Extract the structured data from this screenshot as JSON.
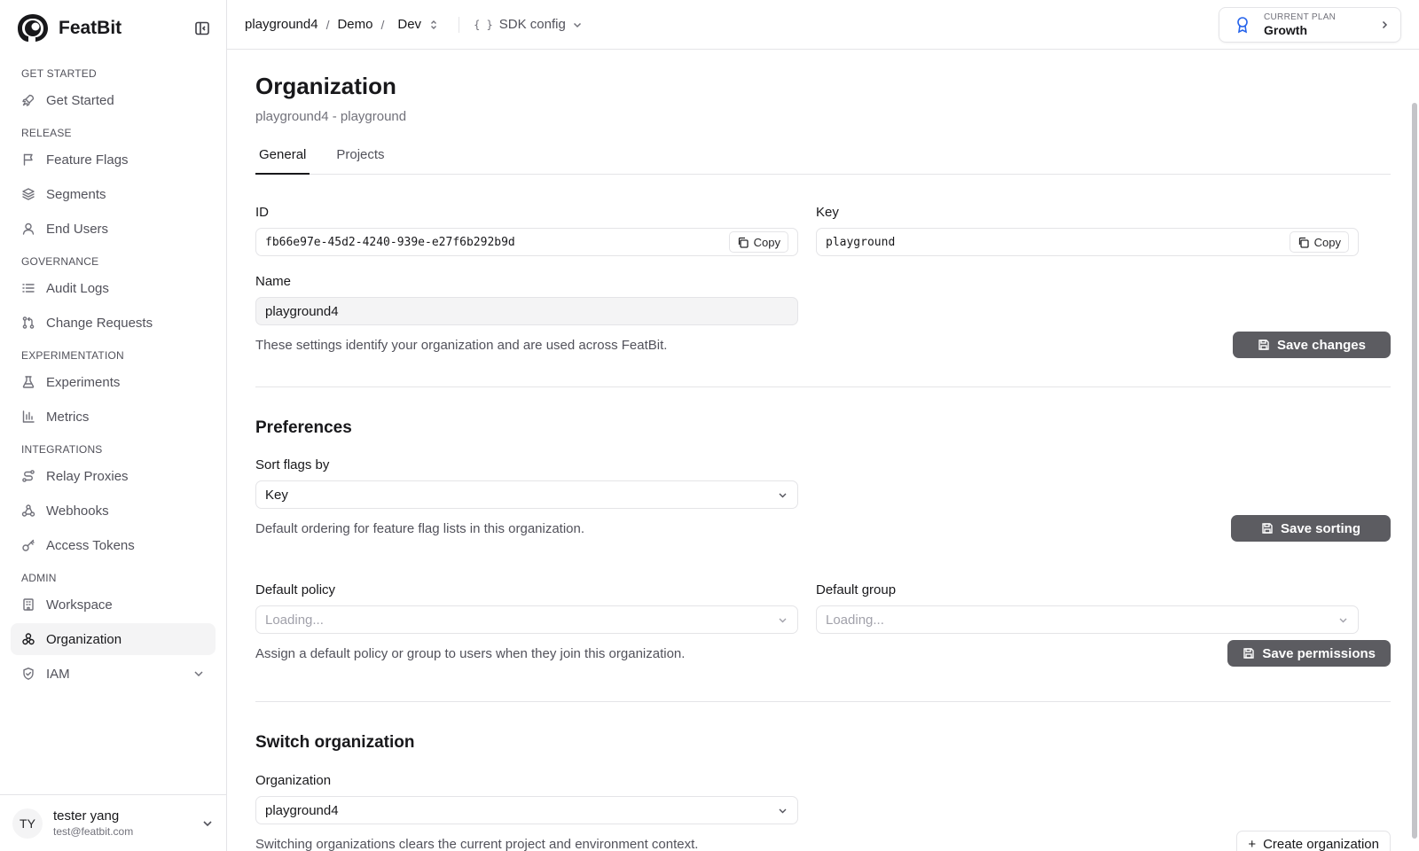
{
  "brand": {
    "name": "FeatBit"
  },
  "sidebar": {
    "groups": [
      {
        "title": "GET STARTED",
        "items": [
          {
            "label": "Get Started",
            "icon": "rocket-icon"
          }
        ]
      },
      {
        "title": "RELEASE",
        "items": [
          {
            "label": "Feature Flags",
            "icon": "flag-icon"
          },
          {
            "label": "Segments",
            "icon": "layers-icon"
          },
          {
            "label": "End Users",
            "icon": "user-icon"
          }
        ]
      },
      {
        "title": "GOVERNANCE",
        "items": [
          {
            "label": "Audit Logs",
            "icon": "list-icon"
          },
          {
            "label": "Change Requests",
            "icon": "git-pull-request-icon"
          }
        ]
      },
      {
        "title": "EXPERIMENTATION",
        "items": [
          {
            "label": "Experiments",
            "icon": "flask-icon"
          },
          {
            "label": "Metrics",
            "icon": "bar-chart-icon"
          }
        ]
      },
      {
        "title": "INTEGRATIONS",
        "items": [
          {
            "label": "Relay Proxies",
            "icon": "route-icon"
          },
          {
            "label": "Webhooks",
            "icon": "webhook-icon"
          },
          {
            "label": "Access Tokens",
            "icon": "key-icon"
          }
        ]
      },
      {
        "title": "ADMIN",
        "items": [
          {
            "label": "Workspace",
            "icon": "building-icon"
          },
          {
            "label": "Organization",
            "icon": "organization-icon",
            "active": true
          },
          {
            "label": "IAM",
            "icon": "shield-icon",
            "expandable": true
          }
        ]
      }
    ]
  },
  "user": {
    "initials": "TY",
    "name": "tester yang",
    "email": "test@featbit.com"
  },
  "topbar": {
    "org": "playground4",
    "project": "Demo",
    "env": "Dev",
    "sdk_braces": "{ }",
    "sdk_label": "SDK config",
    "plan_label": "CURRENT PLAN",
    "plan_name": "Growth"
  },
  "page": {
    "title": "Organization",
    "subtitle": "playground4 - playground",
    "tabs": [
      "General",
      "Projects"
    ],
    "active_tab": "General"
  },
  "general": {
    "id_label": "ID",
    "id_value": "fb66e97e-45d2-4240-939e-e27f6b292b9d",
    "key_label": "Key",
    "key_value": "playground",
    "copy_label": "Copy",
    "name_label": "Name",
    "name_value": "playground4",
    "help": "These settings identify your organization and are used across FeatBit.",
    "save_label": "Save changes"
  },
  "preferences": {
    "title": "Preferences",
    "sort_label": "Sort flags by",
    "sort_value": "Key",
    "sort_help": "Default ordering for feature flag lists in this organization.",
    "save_sort_label": "Save sorting",
    "policy_label": "Default policy",
    "policy_value": "Loading...",
    "group_label": "Default group",
    "group_value": "Loading...",
    "perm_help": "Assign a default policy or group to users when they join this organization.",
    "save_perm_label": "Save permissions"
  },
  "switch": {
    "title": "Switch organization",
    "org_label": "Organization",
    "org_value": "playground4",
    "help": "Switching organizations clears the current project and environment context.",
    "create_label": "Create organization"
  },
  "colors": {
    "accent": "#2563eb",
    "button_dark": "#5c5c61",
    "border": "#e4e4e7"
  }
}
